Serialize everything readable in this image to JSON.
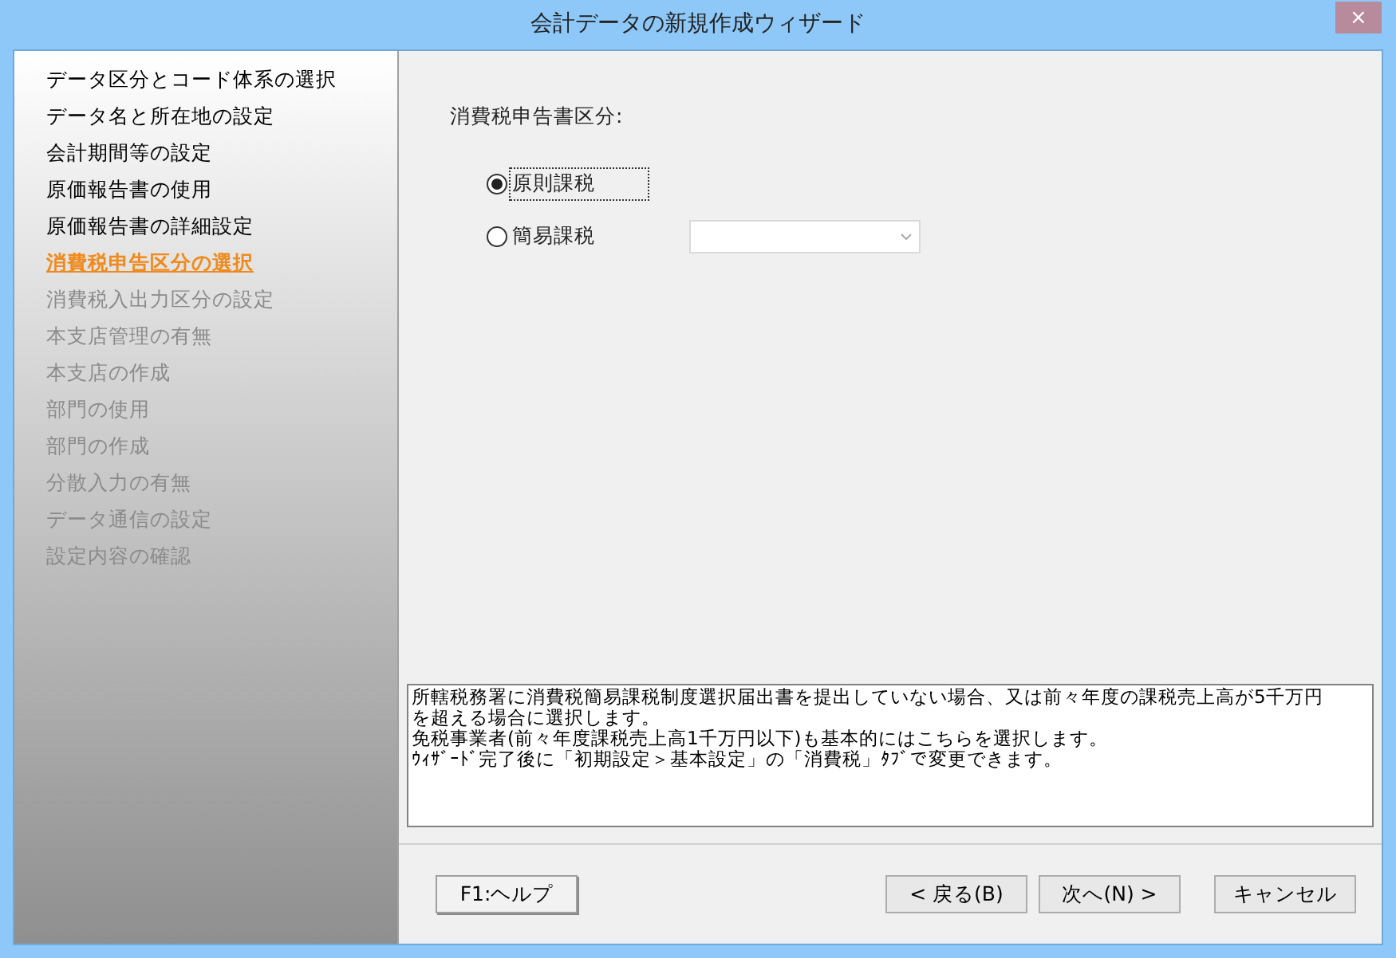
{
  "window": {
    "title": "会計データの新規作成ウィザード",
    "close": "×"
  },
  "steps": [
    {
      "label": "データ区分とコード体系の選択",
      "selected": false,
      "disabled": false
    },
    {
      "label": "データ名と所在地の設定",
      "selected": false,
      "disabled": false
    },
    {
      "label": "会計期間等の設定",
      "selected": false,
      "disabled": false
    },
    {
      "label": "原価報告書の使用",
      "selected": false,
      "disabled": false
    },
    {
      "label": "原価報告書の詳細設定",
      "selected": false,
      "disabled": false
    },
    {
      "label": "消費税申告区分の選択",
      "selected": true,
      "disabled": false
    },
    {
      "label": "消費税入出力区分の設定",
      "selected": false,
      "disabled": true
    },
    {
      "label": "本支店管理の有無",
      "selected": false,
      "disabled": true
    },
    {
      "label": "本支店の作成",
      "selected": false,
      "disabled": true
    },
    {
      "label": "部門の使用",
      "selected": false,
      "disabled": true
    },
    {
      "label": "部門の作成",
      "selected": false,
      "disabled": true
    },
    {
      "label": "分散入力の有無",
      "selected": false,
      "disabled": true
    },
    {
      "label": "データ通信の設定",
      "selected": false,
      "disabled": true
    },
    {
      "label": "設定内容の確認",
      "selected": false,
      "disabled": true
    }
  ],
  "section_label": "消費税申告書区分:",
  "options": [
    {
      "label": "原則課税",
      "selected": true,
      "focused": true
    },
    {
      "label": "簡易課税",
      "selected": false,
      "focused": false,
      "has_dropdown": true
    }
  ],
  "help_text": [
    "所轄税務署に消費税簡易課税制度選択届出書を提出していない場合、又は前々年度の課税売上高が5千万円",
    "を超える場合に選択します。",
    "免税事業者(前々年度課税売上高1千万円以下)も基本的にはこちらを選択します。",
    "ｳｨｻﾞｰﾄﾞ完了後に「初期設定＞基本設定」の「消費税」ﾀﾌﾞで変更できます。"
  ],
  "buttons": {
    "help": "F1:ヘルプ",
    "back": "< 戻る(B)",
    "next": "次へ(N) >",
    "cancel": "キャンセル"
  }
}
